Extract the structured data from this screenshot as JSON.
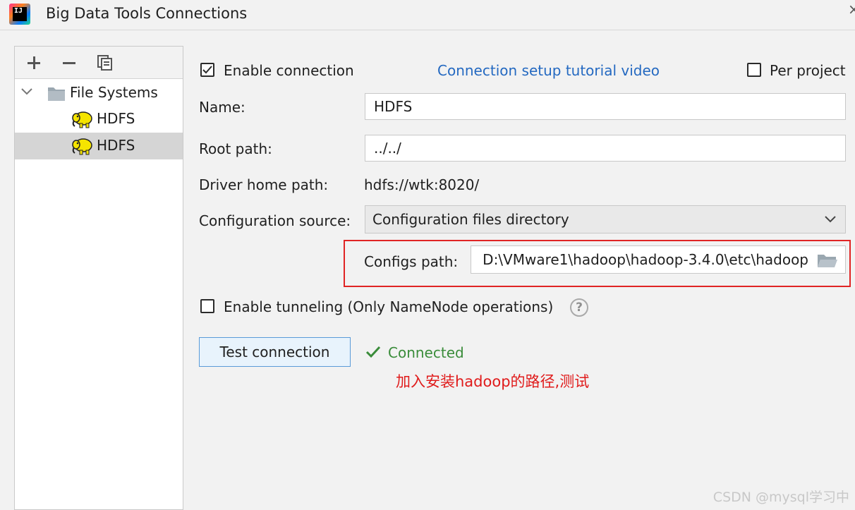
{
  "window": {
    "title": "Big Data Tools Connections"
  },
  "sidebar": {
    "toolbar": {
      "add_icon": "plus-icon",
      "remove_icon": "minus-icon",
      "copy_icon": "copy-icon"
    },
    "tree": {
      "group_label": "File Systems",
      "items": [
        {
          "label": "HDFS",
          "selected": false
        },
        {
          "label": "HDFS",
          "selected": true
        }
      ]
    }
  },
  "form": {
    "enable_connection": {
      "label": "Enable connection",
      "checked": true
    },
    "tutorial_link": "Connection setup tutorial video",
    "per_project": {
      "label": "Per project",
      "checked": false
    },
    "name": {
      "label": "Name:",
      "value": "HDFS"
    },
    "root_path": {
      "label": "Root path:",
      "value": "../../"
    },
    "driver_home": {
      "label": "Driver home path:",
      "value": "hdfs://wtk:8020/"
    },
    "config_source": {
      "label": "Configuration source:",
      "value": "Configuration files directory"
    },
    "configs_path": {
      "label": "Configs path:",
      "value": "D:\\VMware1\\hadoop\\hadoop-3.4.0\\etc\\hadoop"
    },
    "enable_tunneling": {
      "label": "Enable tunneling (Only NameNode operations)",
      "checked": false
    },
    "help_glyph": "?",
    "test_button": "Test connection",
    "status": "Connected"
  },
  "annotation": "加入安装hadoop的路径,测试",
  "watermark": "CSDN @mysql学习中",
  "colors": {
    "link": "#2469c1",
    "success": "#3a8c3a",
    "annotation": "#e01b1b",
    "highlight_box": "#e02424"
  }
}
